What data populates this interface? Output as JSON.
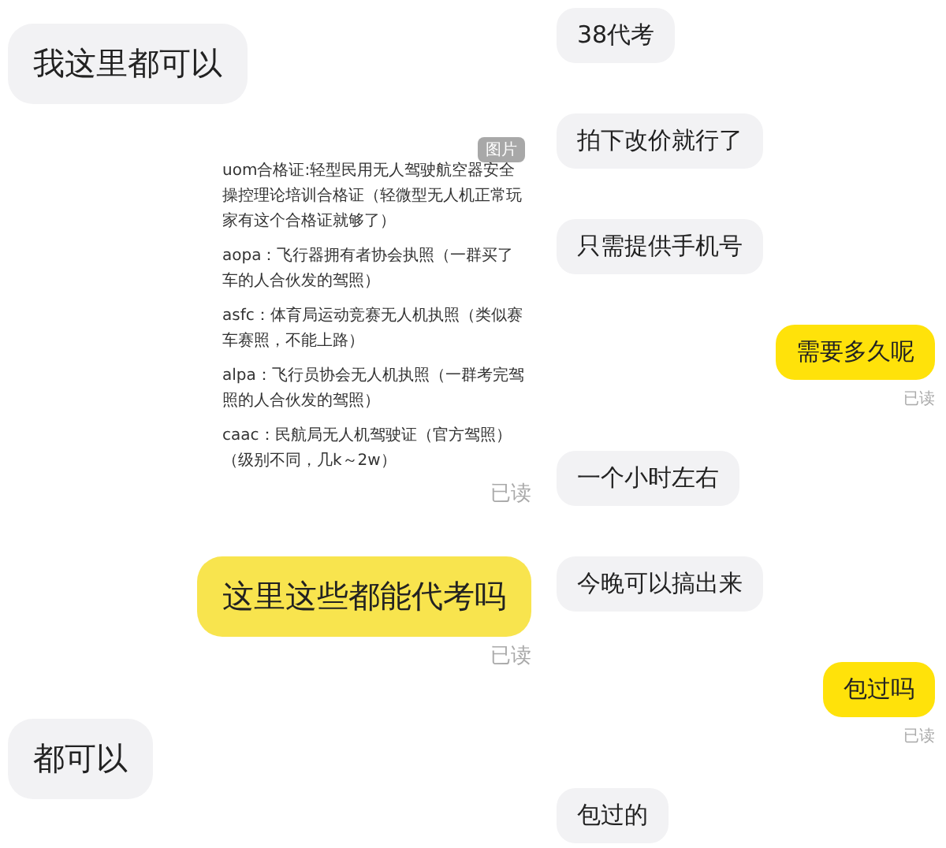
{
  "panels": [
    {
      "messages": [
        {
          "kind": "text",
          "outgoing": false,
          "text": "我这里都可以"
        },
        {
          "kind": "image",
          "outgoing": true,
          "badge": "图片",
          "entries": [
            "uom合格证:轻型民用无人驾驶航空器安全操控理论培训合格证（轻微型无人机正常玩家有这个合格证就够了）",
            "aopa：飞行器拥有者协会执照（一群买了车的人合伙发的驾照）",
            "asfc：体育局运动竞赛无人机执照（类似赛车赛照，不能上路）",
            "alpa：飞行员协会无人机执照（一群考完驾照的人合伙发的驾照）",
            "caac：民航局无人机驾驶证（官方驾照）（级别不同，几k～2w）"
          ],
          "read": "已读"
        },
        {
          "kind": "text",
          "outgoing": true,
          "text": "这里这些都能代考吗",
          "read": "已读"
        },
        {
          "kind": "text",
          "outgoing": false,
          "text": "都可以"
        }
      ]
    },
    {
      "messages": [
        {
          "kind": "text",
          "outgoing": false,
          "text": "38代考"
        },
        {
          "kind": "text",
          "outgoing": false,
          "text": "拍下改价就行了"
        },
        {
          "kind": "text",
          "outgoing": false,
          "text": "只需提供手机号"
        },
        {
          "kind": "text",
          "outgoing": true,
          "text": "需要多久呢",
          "read": "已读"
        },
        {
          "kind": "text",
          "outgoing": false,
          "text": "一个小时左右"
        },
        {
          "kind": "text",
          "outgoing": false,
          "text": "今晚可以搞出来"
        },
        {
          "kind": "text",
          "outgoing": true,
          "text": "包过吗",
          "read": "已读"
        },
        {
          "kind": "text",
          "outgoing": false,
          "text": "包过的"
        }
      ]
    }
  ]
}
